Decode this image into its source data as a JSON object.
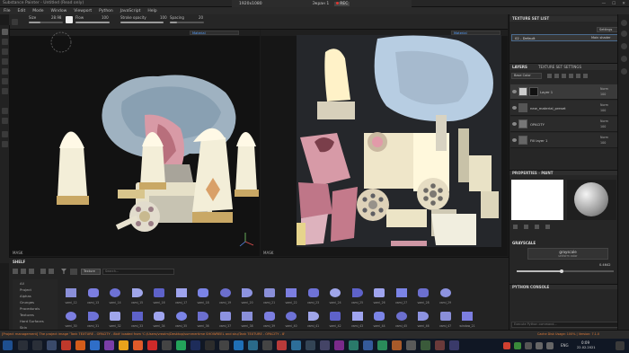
{
  "window": {
    "title": "Substance Painter - Untitled (Read only)",
    "minimize": "—",
    "maximize": "☐",
    "close": "✕"
  },
  "recorder": {
    "resolution": "1920x1080",
    "label": "Экран 1",
    "rec": "REC"
  },
  "menu": [
    "File",
    "Edit",
    "Mode",
    "Window",
    "Viewport",
    "Python",
    "JavaScript",
    "Help"
  ],
  "tool_props": {
    "size_label": "Size",
    "size_value": "28.98",
    "flow_label": "Flow",
    "flow_value": "100",
    "flow_level": 1.0,
    "stroke_label": "Stroke opacity",
    "stroke_value": "100",
    "stroke_level": 1.0,
    "spacing_label": "Spacing",
    "spacing_value": "20",
    "spacing_level": 0.2
  },
  "viewport3d": {
    "material": "Material",
    "mask": "MASK"
  },
  "viewport2d": {
    "material": "Material",
    "mask": "MASK"
  },
  "texture_set_list": {
    "title": "TEXTURE SET LIST",
    "settings": "Settings",
    "item": "02 - Default",
    "shader": "Main shader"
  },
  "layers": {
    "tab1": "LAYERS",
    "tab2": "TEXTURE SET SETTINGS",
    "channel": "Base Color",
    "items": [
      {
        "name": "Layer 1",
        "blend": "Norm",
        "opacity": "100"
      },
      {
        "name": "new_material_preset",
        "blend": "Norm",
        "opacity": "100"
      },
      {
        "name": "OPACITY",
        "blend": "Norm",
        "opacity": "100"
      },
      {
        "name": "Fill layer 1",
        "blend": "Norm",
        "opacity": "100"
      }
    ]
  },
  "properties": {
    "title": "PROPERTIES - PAINT",
    "grayscale_title": "GRAYSCALE",
    "grayscale_label": "grayscale",
    "grayscale_sub": "uniform color",
    "grayscale_value": "0.4642",
    "grayscale_level": 0.4642
  },
  "python_console": {
    "title": "PYTHON CONSOLE",
    "placeholder": "Execute Python command..."
  },
  "shelf": {
    "title": "SHELF",
    "filter_tag": "Texture",
    "search_placeholder": "Search...",
    "categories": [
      "All",
      "Project",
      "Alphas",
      "Grunges",
      "Procedurals",
      "Textures",
      "Hard Surfaces",
      "Skin"
    ],
    "row1": [
      "vami_12",
      "vami_13",
      "vami_14",
      "vami_15",
      "vami_16",
      "vami_17",
      "vami_18",
      "vami_19",
      "vami_20",
      "vami_21",
      "vami_22",
      "vami_23",
      "vami_24",
      "vami_25",
      "vami_26",
      "vami_27",
      "vami_28",
      "vami_29"
    ],
    "row2": [
      "vami_30",
      "vami_31",
      "vami_32",
      "vami_33",
      "vami_34",
      "vami_35",
      "vami_36",
      "vami_37",
      "vami_38",
      "vami_39",
      "vami_40",
      "vami_41",
      "vami_42",
      "vami_43",
      "vami_44",
      "vami_45",
      "vami_46",
      "vami_47",
      "window_21"
    ]
  },
  "status": {
    "message": "[Project management] The project image 'Tank TEXTURE - OPACITY - 8bit' loaded from 'C:/Users/vrealm/Desktop/summertime SHOWREEL and sku/Tank TEXTURE - OPACITY - 8'",
    "cache": "Cache Disk Usage: 100% | Version: 7.1.0"
  },
  "taskbar": {
    "time": "0:09",
    "date": "22.02.2021",
    "lang": "ENG"
  }
}
